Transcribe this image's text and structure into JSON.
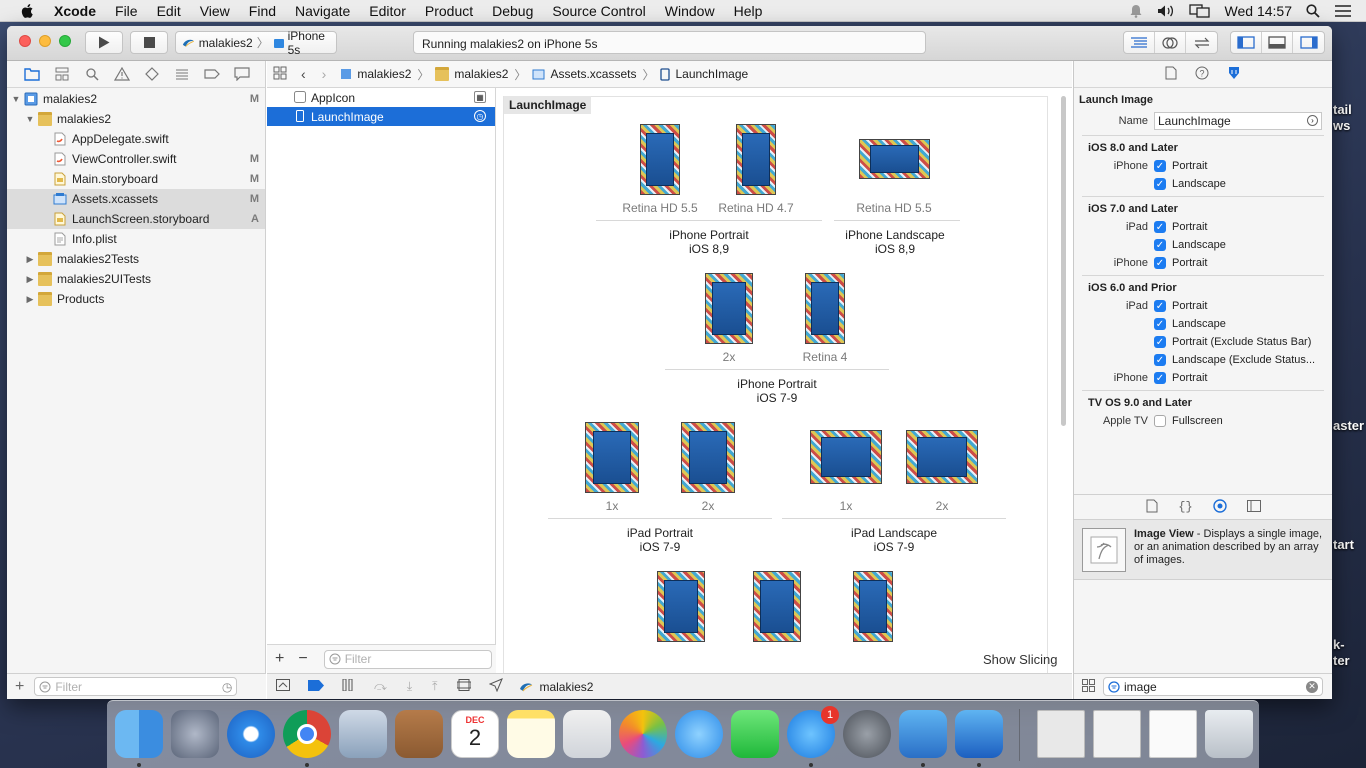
{
  "menubar": {
    "app": "Xcode",
    "items": [
      "File",
      "Edit",
      "View",
      "Find",
      "Navigate",
      "Editor",
      "Product",
      "Debug",
      "Source Control",
      "Window",
      "Help"
    ],
    "clock": "Wed 14:57"
  },
  "toolbar": {
    "scheme": "malakies2",
    "device": "iPhone 5s",
    "status": "Running malakies2 on iPhone 5s"
  },
  "navigator": {
    "tree": [
      {
        "label": "malakies2",
        "badge": "M",
        "depth": 0,
        "icon": "project-icon",
        "expanded": true
      },
      {
        "label": "malakies2",
        "badge": "",
        "depth": 1,
        "icon": "folder-icon",
        "expanded": true
      },
      {
        "label": "AppDelegate.swift",
        "badge": "",
        "depth": 2,
        "icon": "swift-file-icon"
      },
      {
        "label": "ViewController.swift",
        "badge": "M",
        "depth": 2,
        "icon": "swift-file-icon"
      },
      {
        "label": "Main.storyboard",
        "badge": "M",
        "depth": 2,
        "icon": "storyboard-icon"
      },
      {
        "label": "Assets.xcassets",
        "badge": "M",
        "depth": 2,
        "icon": "assets-icon",
        "selected": true
      },
      {
        "label": "LaunchScreen.storyboard",
        "badge": "A",
        "depth": 2,
        "icon": "storyboard-icon",
        "selected": true
      },
      {
        "label": "Info.plist",
        "badge": "",
        "depth": 2,
        "icon": "plist-icon"
      },
      {
        "label": "malakies2Tests",
        "badge": "",
        "depth": 1,
        "icon": "folder-icon",
        "expanded": false
      },
      {
        "label": "malakies2UITests",
        "badge": "",
        "depth": 1,
        "icon": "folder-icon",
        "expanded": false
      },
      {
        "label": "Products",
        "badge": "",
        "depth": 1,
        "icon": "folder-icon",
        "expanded": false
      }
    ],
    "filter_placeholder": "Filter"
  },
  "jumpbar": {
    "crumbs": [
      "malakies2",
      "malakies2",
      "Assets.xcassets",
      "LaunchImage"
    ]
  },
  "assets": {
    "items": [
      "AppIcon",
      "LaunchImage"
    ],
    "selected": 1,
    "filter_placeholder": "Filter"
  },
  "canvas": {
    "set_name": "LaunchImage",
    "show_slicing": "Show Slicing",
    "slot_labels": [
      "Retina HD 5.5",
      "Retina HD 4.7",
      "Retina HD 5.5",
      "2x",
      "Retina 4",
      "1x",
      "2x",
      "1x",
      "2x"
    ],
    "group_labels": [
      [
        "iPhone Portrait",
        "iOS 8,9"
      ],
      [
        "iPhone Landscape",
        "iOS 8,9"
      ],
      [
        "iPhone Portrait",
        "iOS 7-9"
      ],
      [
        "iPad Portrait",
        "iOS 7-9"
      ],
      [
        "iPad Landscape",
        "iOS 7-9"
      ]
    ]
  },
  "editor_bottom": {
    "target": "malakies2"
  },
  "inspector": {
    "title": "Launch Image",
    "name_label": "Name",
    "name_value": "LaunchImage",
    "sections": [
      {
        "title": "iOS 8.0 and Later",
        "rows": [
          {
            "k": "iPhone",
            "v": "Portrait",
            "on": true
          },
          {
            "k": "",
            "v": "Landscape",
            "on": true
          }
        ]
      },
      {
        "title": "iOS 7.0 and Later",
        "rows": [
          {
            "k": "iPad",
            "v": "Portrait",
            "on": true
          },
          {
            "k": "",
            "v": "Landscape",
            "on": true
          },
          {
            "k": "iPhone",
            "v": "Portrait",
            "on": true
          }
        ]
      },
      {
        "title": "iOS 6.0 and Prior",
        "rows": [
          {
            "k": "iPad",
            "v": "Portrait",
            "on": true
          },
          {
            "k": "",
            "v": "Landscape",
            "on": true
          },
          {
            "k": "",
            "v": "Portrait (Exclude Status Bar)",
            "on": true
          },
          {
            "k": "",
            "v": "Landscape (Exclude Status...",
            "on": true
          },
          {
            "k": "iPhone",
            "v": "Portrait",
            "on": true
          }
        ]
      },
      {
        "title": "TV OS 9.0 and Later",
        "rows": [
          {
            "k": "Apple TV",
            "v": "Fullscreen",
            "on": false
          }
        ]
      }
    ],
    "library": {
      "title": "Image View",
      "desc": " - Displays a single image, or an animation described by an array of images."
    },
    "search": "image"
  },
  "desktop_text": [
    "tail",
    "ws",
    "aster",
    "tart",
    "k-",
    "ter"
  ],
  "dock": {
    "badge": "1",
    "calendar_month": "DEC",
    "calendar_day": "2"
  }
}
